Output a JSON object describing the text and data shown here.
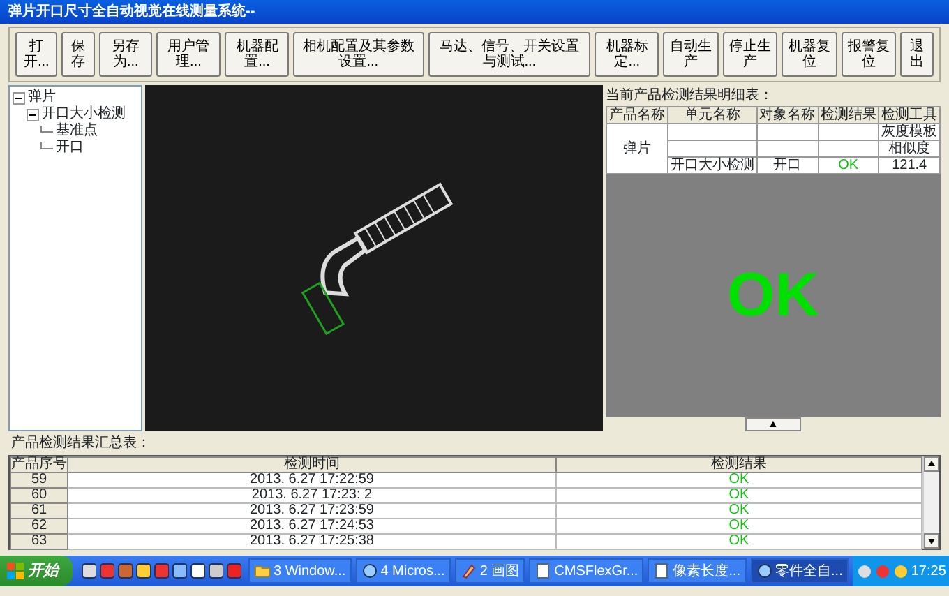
{
  "window": {
    "title": "弹片开口尺寸全自动视觉在线测量系统--"
  },
  "toolbar": [
    {
      "label": "打开..."
    },
    {
      "label": "保存"
    },
    {
      "label": "另存为..."
    },
    {
      "label": "用户管理..."
    },
    {
      "label": "机器配置..."
    },
    {
      "label": "相机配置及其参数设置..."
    },
    {
      "label": "马达、信号、开关设置与测试..."
    },
    {
      "label": "机器标定..."
    },
    {
      "label": "自动生产"
    },
    {
      "label": "停止生产"
    },
    {
      "label": "机器复位"
    },
    {
      "label": "报警复位"
    },
    {
      "label": "退出"
    }
  ],
  "tree": [
    {
      "label": "弹片",
      "expanded": true,
      "children": [
        {
          "label": "开口大小检测",
          "expanded": true,
          "children": [
            {
              "label": "基准点"
            },
            {
              "label": "开口"
            }
          ]
        }
      ]
    }
  ],
  "detail": {
    "title": "当前产品检测结果明细表：",
    "columns": [
      "产品名称",
      "单元名称",
      "对象名称",
      "检测结果",
      "检测工具"
    ],
    "product": "弹片",
    "rows": [
      {
        "tool": "灰度模板"
      },
      {
        "tool": "相似度"
      },
      {
        "unit": "开口大小检测",
        "object": "开口",
        "result": "OK",
        "tool": "121.4"
      }
    ],
    "big_result": "OK",
    "toggle": "▲"
  },
  "summary": {
    "title": "产品检测结果汇总表：",
    "columns": [
      "产品序号",
      "检测时间",
      "检测结果"
    ],
    "rows": [
      [
        "59",
        "2013. 6.27 17:22:59",
        "OK"
      ],
      [
        "60",
        "2013. 6.27 17:23: 2",
        "OK"
      ],
      [
        "61",
        "2013. 6.27 17:23:59",
        "OK"
      ],
      [
        "62",
        "2013. 6.27 17:24:53",
        "OK"
      ],
      [
        "63",
        "2013. 6.27 17:25:38",
        "OK"
      ]
    ]
  },
  "taskbar": {
    "start": "开始",
    "tasks": [
      {
        "label": "3 Window...",
        "selected": false,
        "kind": "folder"
      },
      {
        "label": "4 Micros...",
        "selected": false,
        "kind": "app"
      },
      {
        "label": "2 画图",
        "selected": false,
        "kind": "paint"
      },
      {
        "label": "CMSFlexGr...",
        "selected": false,
        "kind": "doc"
      },
      {
        "label": "像素长度...",
        "selected": false,
        "kind": "doc"
      },
      {
        "label": "零件全自...",
        "selected": true,
        "kind": "app"
      }
    ],
    "time": "17:25"
  }
}
